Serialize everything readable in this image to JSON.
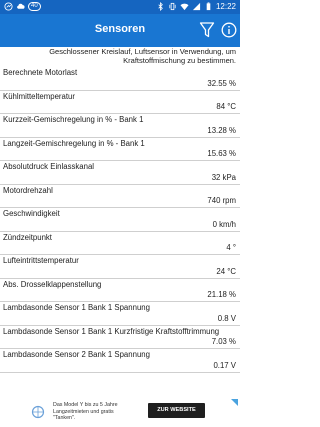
{
  "status_bar": {
    "time": "12:22",
    "badge": "40",
    "background": "#1565c0"
  },
  "app_bar": {
    "title": "Sensoren",
    "background": "#1976d2",
    "icons": [
      "filter-icon",
      "info-icon"
    ]
  },
  "intro": "Geschlossener Kreislauf, Luftsensor in Verwendung, um Kraftstoffmischung zu bestimmen.",
  "sensors": [
    {
      "label": "Berechnete Motorlast",
      "value": "32.55 %"
    },
    {
      "label": "Kühlmitteltemperatur",
      "value": "84 °C"
    },
    {
      "label": "Kurzzeit-Gemischregelung in % - Bank 1",
      "value": "13.28 %"
    },
    {
      "label": "Langzeit-Gemischregelung in % - Bank 1",
      "value": "15.63 %"
    },
    {
      "label": "Absolutdruck Einlasskanal",
      "value": "32 kPa"
    },
    {
      "label": "Motordrehzahl",
      "value": "740 rpm"
    },
    {
      "label": "Geschwindigkeit",
      "value": "0 km/h"
    },
    {
      "label": "Zündzeitpunkt",
      "value": "4 °"
    },
    {
      "label": "Lufteintrittstemperatur",
      "value": "24 °C"
    },
    {
      "label": "Abs. Drosselklappenstellung",
      "value": "21.18 %"
    },
    {
      "label": "Lambdasonde Sensor 1 Bank 1 Spannung",
      "value": "0.8 V"
    },
    {
      "label": "Lambdasonde Sensor 1 Bank 1 Kurzfristige Kraftstofftrimmung",
      "value": "7.03 %"
    },
    {
      "label": "Lambdasonde Sensor 2 Bank 1 Spannung",
      "value": "0.17 V"
    }
  ],
  "ad": {
    "text": "Das Model Y bis zu 5 Jahre Langzeitmieten und gratis \"Tanken\".",
    "button_label": "ZUR WEBSITE"
  }
}
